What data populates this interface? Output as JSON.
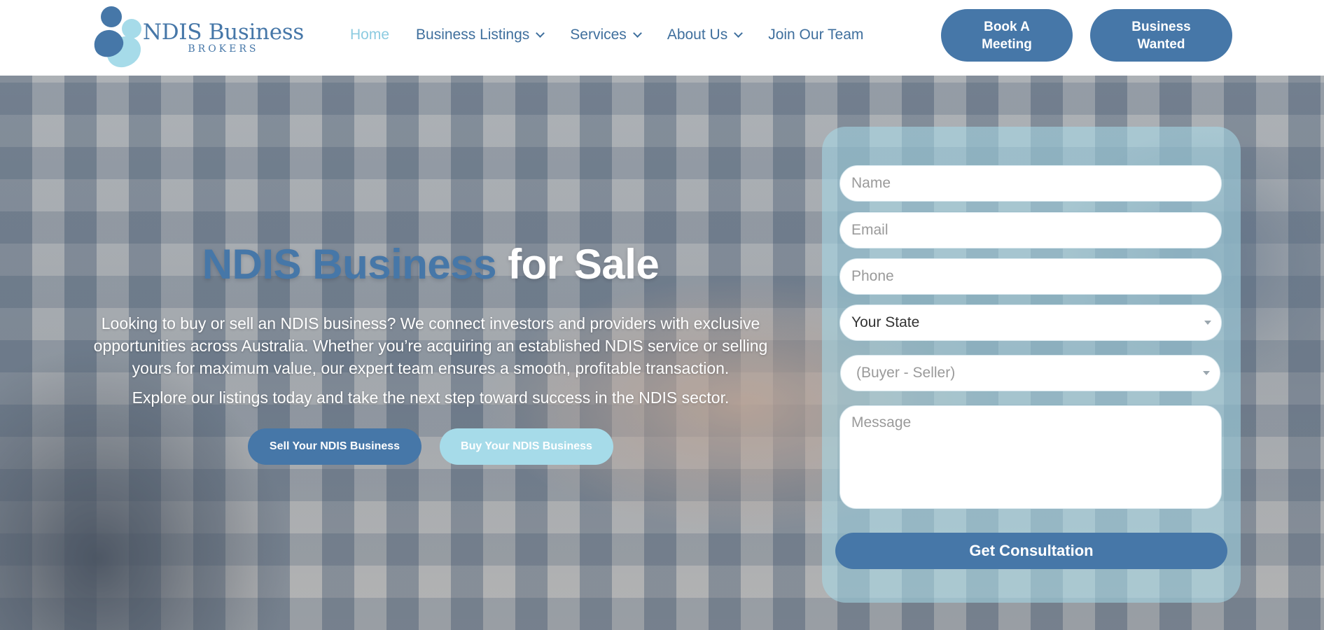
{
  "brand": {
    "title": "NDIS Business",
    "subtitle": "BROKERS",
    "colors": {
      "primary": "#4677a8",
      "accent": "#a6dbe9",
      "white": "#ffffff"
    }
  },
  "nav": {
    "items": [
      {
        "label": "Home",
        "active": true,
        "dropdown": false
      },
      {
        "label": "Business Listings",
        "active": false,
        "dropdown": true
      },
      {
        "label": "Services",
        "active": false,
        "dropdown": true
      },
      {
        "label": "About Us",
        "active": false,
        "dropdown": true
      },
      {
        "label": "Join Our Team",
        "active": false,
        "dropdown": false
      }
    ]
  },
  "header_buttons": {
    "book_line1": "Book A",
    "book_line2": "Meeting",
    "wanted_line1": "Business",
    "wanted_line2": "Wanted"
  },
  "hero": {
    "title_blue": "NDIS Business",
    "title_white": "for Sale",
    "description": "Looking to buy or sell an NDIS business? We connect investors and providers with exclusive opportunities across Australia. Whether you’re acquiring an established NDIS service or selling yours for maximum value, our expert team ensures a smooth, profitable transaction.",
    "description2": "Explore our listings today and take the next step toward success in the NDIS sector.",
    "sell_button": "Sell Your NDIS Business",
    "buy_button": "Buy Your NDIS Business"
  },
  "form": {
    "name_placeholder": "Name",
    "email_placeholder": "Email",
    "phone_placeholder": "Phone",
    "state_value": "Your State",
    "role_value": "(Buyer - Seller)",
    "message_placeholder": "Message",
    "submit_label": "Get Consultation"
  }
}
